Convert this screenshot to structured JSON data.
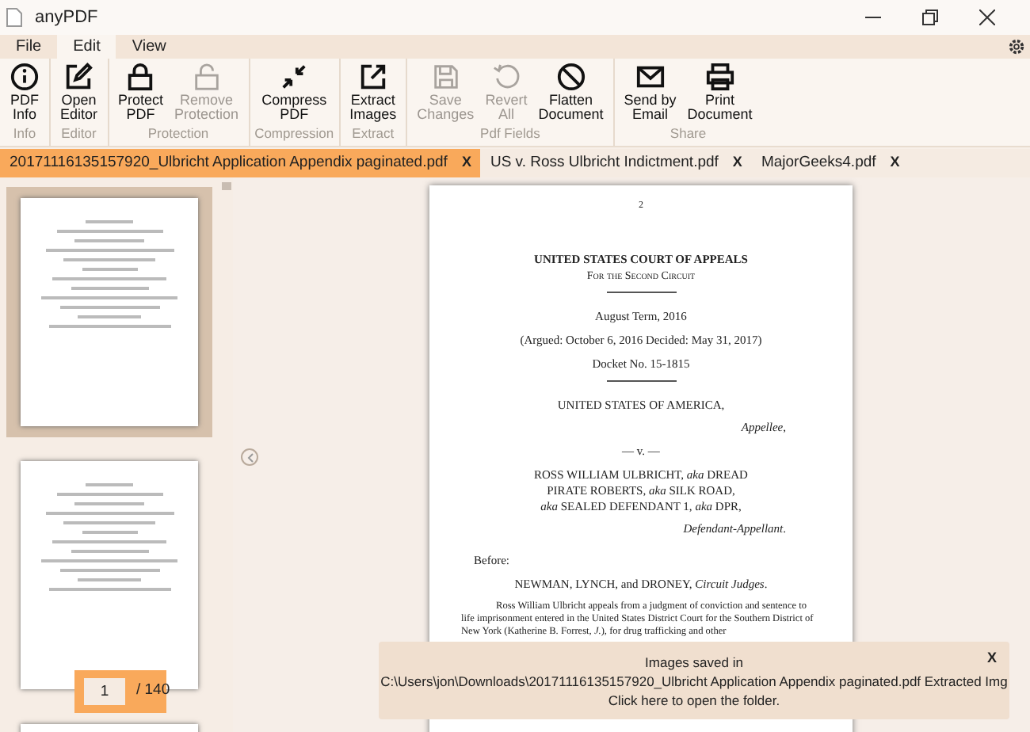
{
  "window": {
    "title": "anyPDF"
  },
  "menu": [
    {
      "label": "File",
      "selected": false
    },
    {
      "label": "Edit",
      "selected": true
    },
    {
      "label": "View",
      "selected": false
    }
  ],
  "ribbon": [
    {
      "group": "Info",
      "buttons": [
        {
          "lines": [
            "PDF",
            "Info"
          ],
          "disabled": false
        }
      ]
    },
    {
      "group": "Editor",
      "buttons": [
        {
          "lines": [
            "Open",
            "Editor"
          ],
          "disabled": false
        }
      ]
    },
    {
      "group": "Protection",
      "buttons": [
        {
          "lines": [
            "Protect",
            "PDF"
          ],
          "disabled": false
        },
        {
          "lines": [
            "Remove",
            "Protection"
          ],
          "disabled": true
        }
      ]
    },
    {
      "group": "Compression",
      "buttons": [
        {
          "lines": [
            "Compress",
            "PDF"
          ],
          "disabled": false
        }
      ]
    },
    {
      "group": "Extract",
      "buttons": [
        {
          "lines": [
            "Extract",
            "Images"
          ],
          "disabled": false
        }
      ]
    },
    {
      "group": "Pdf Fields",
      "buttons": [
        {
          "lines": [
            "Save",
            "Changes"
          ],
          "disabled": true
        },
        {
          "lines": [
            "Revert",
            "All"
          ],
          "disabled": true
        },
        {
          "lines": [
            "Flatten",
            "Document"
          ],
          "disabled": false
        }
      ]
    },
    {
      "group": "Share",
      "buttons": [
        {
          "lines": [
            "Send by",
            "Email"
          ],
          "disabled": false
        },
        {
          "lines": [
            "Print",
            "Document"
          ],
          "disabled": false
        }
      ]
    }
  ],
  "tabs": [
    {
      "label": "20171116135157920_Ulbricht Application Appendix paginated.pdf",
      "close": "X",
      "selected": true
    },
    {
      "label": "US v. Ross Ulbricht Indictment.pdf",
      "close": "X",
      "selected": false
    },
    {
      "label": "MajorGeeks4.pdf",
      "close": "X",
      "selected": false
    }
  ],
  "thumbnails": [
    {
      "selected": true
    },
    {
      "selected": false
    },
    {
      "selected": false
    }
  ],
  "page_counter": {
    "value": "1",
    "total": "/ 140"
  },
  "document": {
    "page_number": "2",
    "lines": [
      {
        "kind": "heading",
        "text": "UNITED STATES COURT OF APPEALS"
      },
      {
        "kind": "smallcaps",
        "text": "For the Second Circuit"
      },
      {
        "kind": "rule"
      },
      {
        "kind": "center",
        "text": "August Term, 2016"
      },
      {
        "kind": "center",
        "text": "(Argued: October 6, 2016    Decided: May 31, 2017)"
      },
      {
        "kind": "center",
        "text": "Docket No. 15-1815"
      },
      {
        "kind": "rule"
      },
      {
        "kind": "center",
        "text": "UNITED STATES OF AMERICA,"
      },
      {
        "kind": "right",
        "text": "*Appellee*,"
      },
      {
        "kind": "center",
        "text": "— v. —"
      },
      {
        "kind": "center",
        "text": "ROSS WILLIAM ULBRICHT, *aka* DREAD"
      },
      {
        "kind": "center_tight",
        "text": "PIRATE ROBERTS, *aka* SILK ROAD,"
      },
      {
        "kind": "center_tight",
        "text": "*aka* SEALED DEFENDANT 1, *aka* DPR,"
      },
      {
        "kind": "right",
        "text": "*Defendant-Appellant*."
      },
      {
        "kind": "left",
        "text": "Before:"
      },
      {
        "kind": "center",
        "text": "NEWMAN, LYNCH, and DRONEY, *Circuit Judges*."
      },
      {
        "kind": "paragraph",
        "text": "Ross William Ulbricht appeals from a judgment of conviction and sentence to life imprisonment entered in the United States District Court for the Southern District of New York (Katherine B. Forrest, *J.*), for drug trafficking and other"
      }
    ]
  },
  "toast": {
    "lines": [
      "Images saved in",
      "C:\\Users\\jon\\Downloads\\20171116135157920_Ulbricht Application Appendix paginated.pdf Extracted Img",
      "Click here to open the folder."
    ],
    "close": "X"
  }
}
